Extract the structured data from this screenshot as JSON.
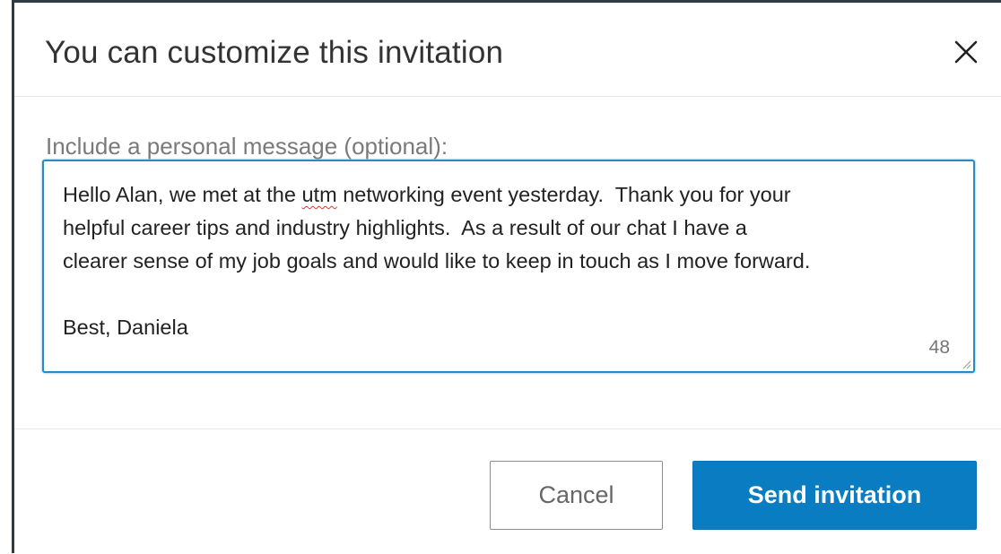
{
  "dialog": {
    "title": "You can customize this invitation",
    "close_icon": "close-icon"
  },
  "message": {
    "label": "Include a personal message (optional):",
    "line1_a": "Hello Alan, we met at the ",
    "line1_misspelled": "utm",
    "line1_b": " networking event yesterday.  Thank you for your",
    "line2": "helpful career tips and industry highlights.  As a result of our chat I have a",
    "line3": "clearer sense of my job goals and would like to keep in touch as I move forward.",
    "line4": "",
    "line5": "Best, Daniela",
    "remaining_chars": "48"
  },
  "footer": {
    "cancel_label": "Cancel",
    "send_label": "Send invitation"
  },
  "colors": {
    "accent": "#0a7cc2",
    "focus_border": "#2b8ac4",
    "spellcheck": "#d23a3a"
  }
}
